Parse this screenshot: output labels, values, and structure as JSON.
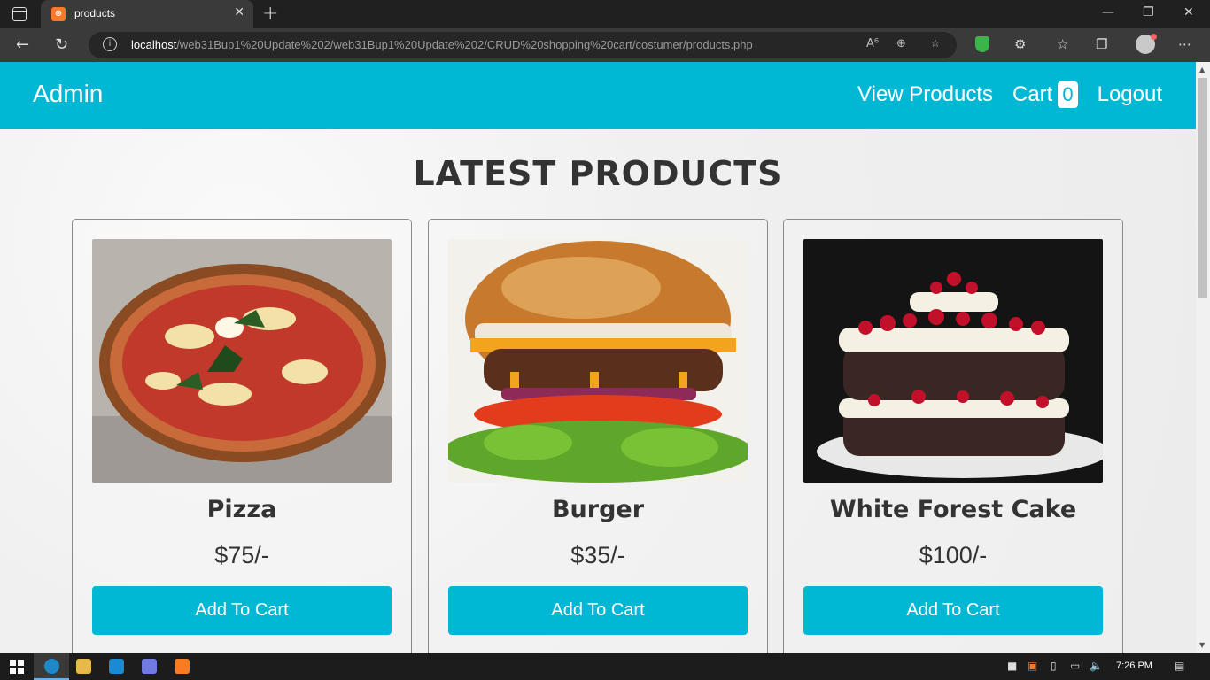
{
  "browser": {
    "tab_title": "products",
    "url_host": "localhost",
    "url_path": "/web31Bup1%20Update%202/web31Bup1%20Update%202/CRUD%20shopping%20cart/costumer/products.php"
  },
  "header": {
    "logo": "Admin",
    "nav": {
      "view_products": "View Products",
      "cart": "Cart",
      "cart_count": "0",
      "logout": "Logout"
    }
  },
  "main": {
    "heading": "LATEST PRODUCTS",
    "products": [
      {
        "name": "Pizza",
        "price": "$75/-",
        "button": "Add To Cart"
      },
      {
        "name": "Burger",
        "price": "$35/-",
        "button": "Add To Cart"
      },
      {
        "name": "White Forest Cake",
        "price": "$100/-",
        "button": "Add To Cart"
      }
    ]
  },
  "taskbar": {
    "time": "7:26 PM"
  },
  "colors": {
    "accent": "#00b7d4",
    "text": "#333333"
  }
}
